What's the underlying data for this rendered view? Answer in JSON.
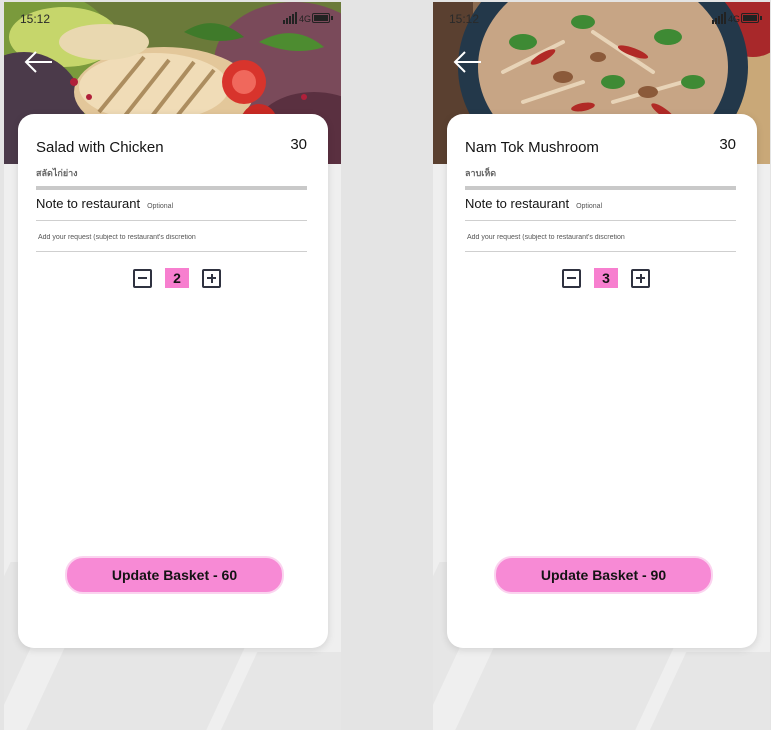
{
  "screens": [
    {
      "time": "15:12",
      "network": "4G",
      "dish_name": "Salad with Chicken",
      "dish_price": "30",
      "dish_subname": "สลัดไก่ย่าง",
      "note_title": "Note to restaurant",
      "note_optional": "Optional",
      "note_placeholder": "Add your request (subject to restaurant's discretion",
      "quantity": "2",
      "update_label": "Update Basket - 60"
    },
    {
      "time": "15:12",
      "network": "4G",
      "dish_name": "Nam Tok Mushroom",
      "dish_price": "30",
      "dish_subname": "ลาบเห็ด",
      "note_title": "Note to restaurant",
      "note_optional": "Optional",
      "note_placeholder": "Add your request (subject to restaurant's discretion",
      "quantity": "3",
      "update_label": "Update Basket - 90"
    }
  ],
  "colors": {
    "accent_pink": "#f77fcf",
    "button_pink": "#f78ad5",
    "icon_dark": "#2f3240"
  },
  "icons": {
    "back": "arrow-left-icon",
    "minus": "minus-square-icon",
    "plus": "plus-square-icon",
    "battery": "battery-icon",
    "signal": "signal-bars-icon"
  }
}
